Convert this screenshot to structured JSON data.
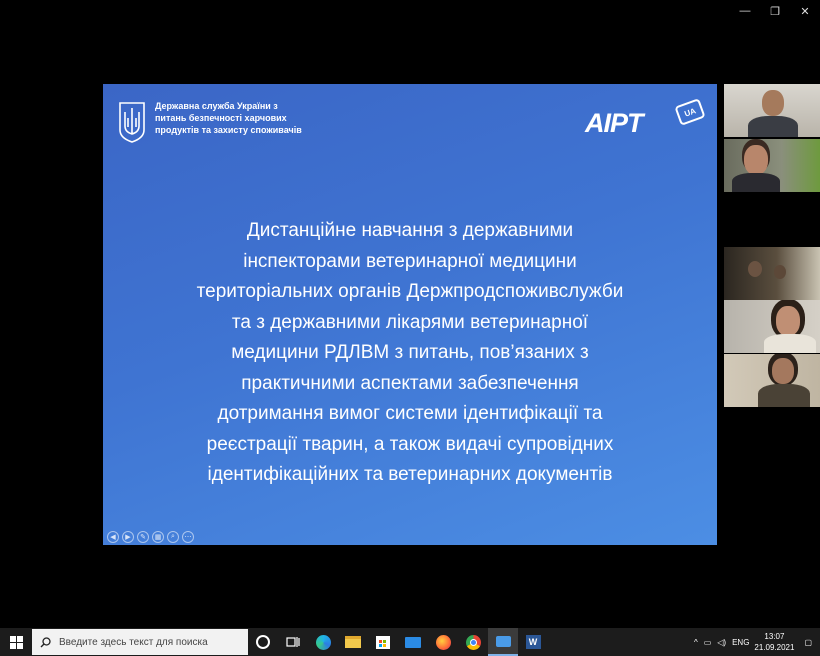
{
  "window": {
    "minimize": "—",
    "restore": "❐",
    "close": "✕"
  },
  "slide": {
    "org_lines": [
      "Державна служба України з",
      "питань безпечності харчових",
      "продуктів та захисту споживачів"
    ],
    "logo_text": "AIPT",
    "logo_badge": "UA",
    "title_lines": [
      "Дистанційне навчання з державними",
      "інспекторами ветеринарної медицини",
      "територіальних органів Держпродспоживслужби",
      "та з державними лікарями ветеринарної",
      "медицини РДЛВМ з питань, пов’язаних з",
      "практичними аспектами забезпечення",
      "дотримання вимог системи ідентифікації та",
      "реєстрації тварин, а також видачі супровідних",
      "ідентифікаційних та ветеринарних документів"
    ]
  },
  "taskbar": {
    "search_placeholder": "Введите здесь текст для поиска",
    "lang": "ENG",
    "time": "13:07",
    "date": "21.09.2021"
  }
}
